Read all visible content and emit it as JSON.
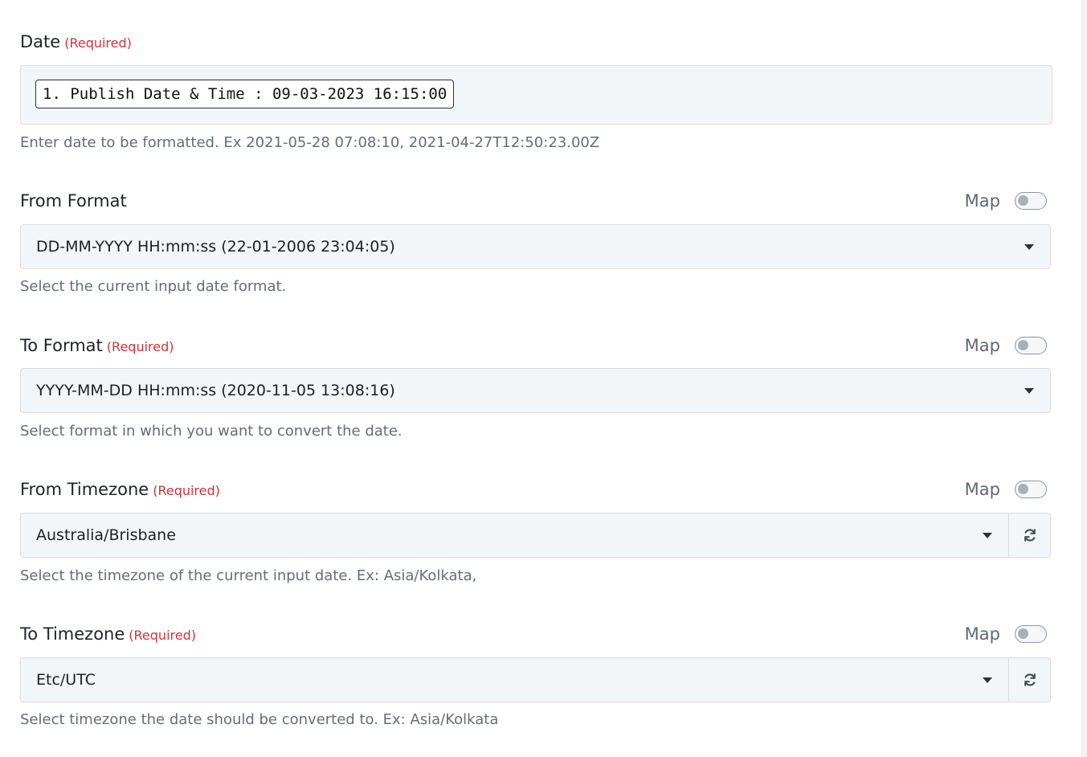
{
  "fields": {
    "date": {
      "label": "Date",
      "required": "(Required)",
      "value": "1. Publish Date & Time : 09-03-2023 16:15:00",
      "help": "Enter date to be formatted. Ex 2021-05-28 07:08:10, 2021-04-27T12:50:23.00Z"
    },
    "from_format": {
      "label": "From Format",
      "map_label": "Map",
      "map_on": false,
      "value": "DD-MM-YYYY HH:mm:ss (22-01-2006 23:04:05)",
      "help": "Select the current input date format."
    },
    "to_format": {
      "label": "To Format",
      "required": "(Required)",
      "map_label": "Map",
      "map_on": false,
      "value": "YYYY-MM-DD HH:mm:ss (2020-11-05 13:08:16)",
      "help": "Select format in which you want to convert the date."
    },
    "from_timezone": {
      "label": "From Timezone",
      "required": "(Required)",
      "map_label": "Map",
      "map_on": false,
      "value": "Australia/Brisbane",
      "help": "Select the timezone of the current input date. Ex: Asia/Kolkata,"
    },
    "to_timezone": {
      "label": "To Timezone",
      "required": "(Required)",
      "map_label": "Map",
      "map_on": false,
      "value": "Etc/UTC",
      "help": "Select timezone the date should be converted to. Ex: Asia/Kolkata"
    }
  },
  "icons": {
    "dropdown": "caret-down-icon",
    "refresh": "refresh-icon"
  },
  "colors": {
    "required": "#d0343c",
    "input_bg": "#f3f6f9",
    "help_text": "#656d75"
  }
}
